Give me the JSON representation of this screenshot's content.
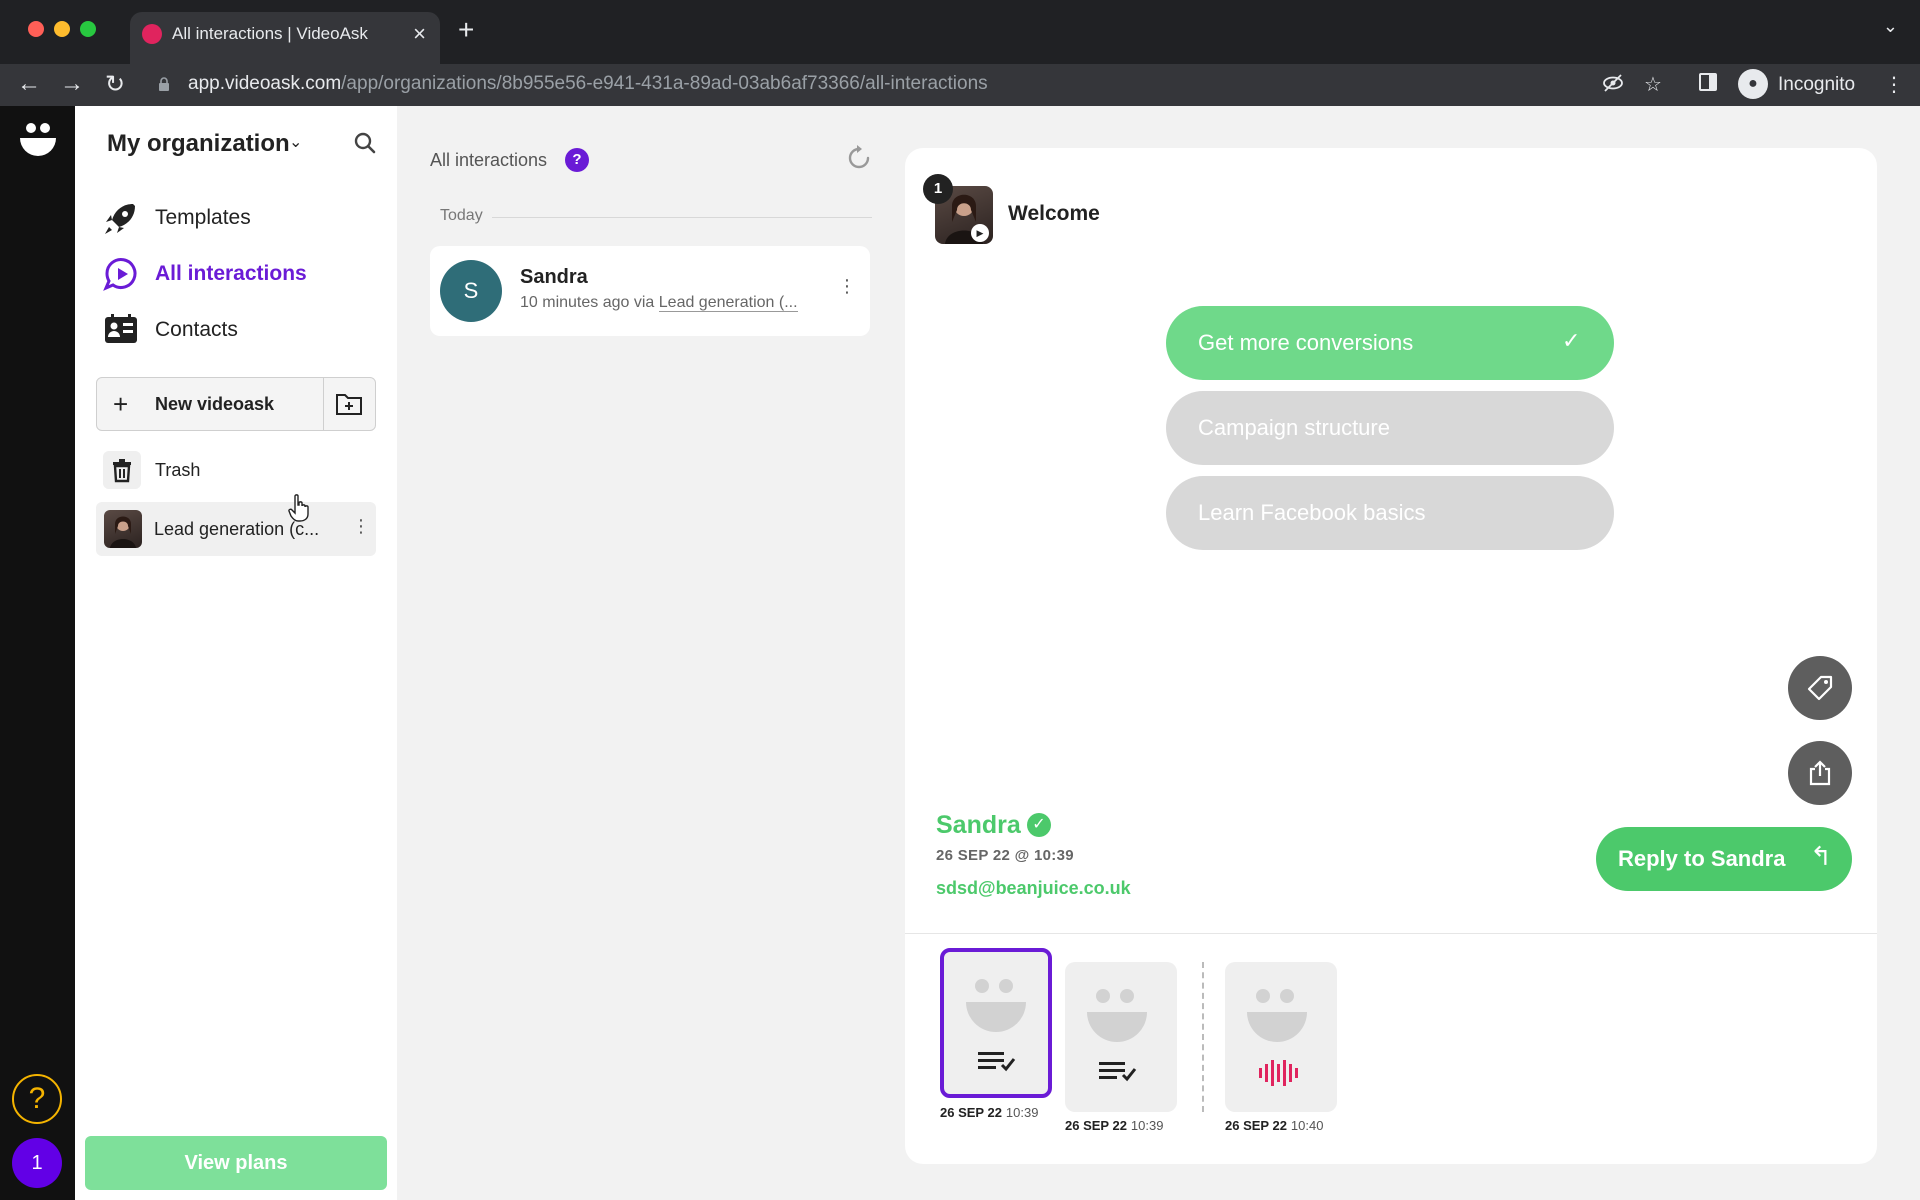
{
  "browser": {
    "tab_title": "All interactions | VideoAsk",
    "url_host": "app.videoask.com",
    "url_path": "/app/organizations/8b955e56-e941-431a-89ad-03ab6af73366/all-interactions",
    "profile_label": "Incognito"
  },
  "sidebar": {
    "org_name": "My organization",
    "nav": [
      {
        "label": "Templates",
        "icon": "rocket-icon"
      },
      {
        "label": "All interactions",
        "icon": "interactions-icon",
        "active": true
      },
      {
        "label": "Contacts",
        "icon": "contacts-icon"
      }
    ],
    "new_button_label": "New videoask",
    "trash_label": "Trash",
    "folder_label": "Lead generation (c...",
    "view_plans_label": "View plans"
  },
  "rail": {
    "help_label": "?",
    "avatar_label": "1"
  },
  "list": {
    "title": "All interactions",
    "help_badge": "?",
    "group_label": "Today",
    "items": [
      {
        "initial": "S",
        "name": "Sandra",
        "time": "10 minutes ago via",
        "source": "Lead generation (..."
      }
    ]
  },
  "detail": {
    "step_number": "1",
    "step_title": "Welcome",
    "choices": [
      {
        "label": "Get more conversions",
        "selected": true
      },
      {
        "label": "Campaign structure",
        "selected": false
      },
      {
        "label": "Learn Facebook basics",
        "selected": false
      }
    ],
    "respondent": {
      "name": "Sandra",
      "datetime": "26 SEP 22 @ 10:39",
      "email": "sdsd@beanjuice.co.uk"
    },
    "reply_label": "Reply to Sandra",
    "timeline": [
      {
        "date": "26 SEP 22",
        "time": "10:39",
        "kind": "choice",
        "selected": true
      },
      {
        "date": "26 SEP 22",
        "time": "10:39",
        "kind": "choice",
        "selected": false
      },
      {
        "date": "26 SEP 22",
        "time": "10:40",
        "kind": "audio",
        "selected": false
      }
    ]
  },
  "colors": {
    "brand_purple": "#6a1bd6",
    "accent_green": "#4cc96b",
    "selected_choice": "#6fd98a",
    "avatar_teal": "#2f6d78"
  }
}
